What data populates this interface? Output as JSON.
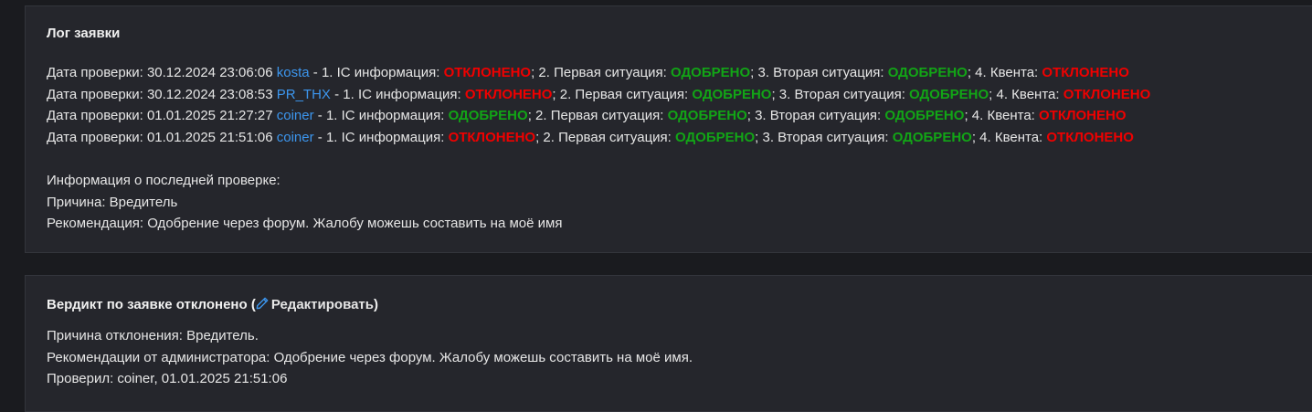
{
  "log": {
    "title": "Лог заявки",
    "entries": [
      {
        "prefix": "Дата проверки: 30.12.2024 23:06:06 ",
        "user": "kosta",
        "s1_label": " - 1. IC информация: ",
        "s1_value": "ОТКЛОНЕНО",
        "s1_status": "rej",
        "s2_label": "; 2. Первая ситуация: ",
        "s2_value": "ОДОБРЕНО",
        "s2_status": "app",
        "s3_label": "; 3. Вторая ситуация: ",
        "s3_value": "ОДОБРЕНО",
        "s3_status": "app",
        "s4_label": "; 4. Квента: ",
        "s4_value": "ОТКЛОНЕНО",
        "s4_status": "rej"
      },
      {
        "prefix": "Дата проверки: 30.12.2024 23:08:53 ",
        "user": "PR_THX",
        "s1_label": " - 1. IC информация: ",
        "s1_value": "ОТКЛОНЕНО",
        "s1_status": "rej",
        "s2_label": "; 2. Первая ситуация: ",
        "s2_value": "ОДОБРЕНО",
        "s2_status": "app",
        "s3_label": "; 3. Вторая ситуация: ",
        "s3_value": "ОДОБРЕНО",
        "s3_status": "app",
        "s4_label": "; 4. Квента: ",
        "s4_value": "ОТКЛОНЕНО",
        "s4_status": "rej"
      },
      {
        "prefix": "Дата проверки: 01.01.2025 21:27:27 ",
        "user": "coiner",
        "s1_label": " - 1. IC информация: ",
        "s1_value": "ОДОБРЕНО",
        "s1_status": "app",
        "s2_label": "; 2. Первая ситуация: ",
        "s2_value": "ОДОБРЕНО",
        "s2_status": "app",
        "s3_label": "; 3. Вторая ситуация: ",
        "s3_value": "ОДОБРЕНО",
        "s3_status": "app",
        "s4_label": "; 4. Квента: ",
        "s4_value": "ОТКЛОНЕНО",
        "s4_status": "rej"
      },
      {
        "prefix": "Дата проверки: 01.01.2025 21:51:06 ",
        "user": "coiner",
        "s1_label": " - 1. IC информация: ",
        "s1_value": "ОТКЛОНЕНО",
        "s1_status": "rej",
        "s2_label": "; 2. Первая ситуация: ",
        "s2_value": "ОДОБРЕНО",
        "s2_status": "app",
        "s3_label": "; 3. Вторая ситуация: ",
        "s3_value": "ОДОБРЕНО",
        "s3_status": "app",
        "s4_label": "; 4. Квента: ",
        "s4_value": "ОТКЛОНЕНО",
        "s4_status": "rej"
      }
    ],
    "last_check_heading": "Информация о последней проверке:",
    "reason_line": "Причина: Вредитель",
    "recommendation_line": "Рекомендация: Одобрение через форум. Жалобу можешь составить на моё имя"
  },
  "verdict": {
    "title_prefix": "Вердикт по заявке отклонено (",
    "edit_label": "Редактировать",
    "title_suffix": ")",
    "reason_line": "Причина отклонения: Вредитель.",
    "recommendation_line": "Рекомендации от администратора: Одобрение через форум. Жалобу можешь составить на моё имя.",
    "checked_by_line": "Проверил: coiner, 01.01.2025 21:51:06"
  },
  "colors": {
    "background": "#1a1b1f",
    "card": "#25262c",
    "text": "#e6e6e6",
    "user_link": "#3c96ee",
    "rejected": "#f00000",
    "approved": "#12a516",
    "pencil_icon": "#3c96ee"
  },
  "icons": {
    "edit": "pencil-icon"
  }
}
